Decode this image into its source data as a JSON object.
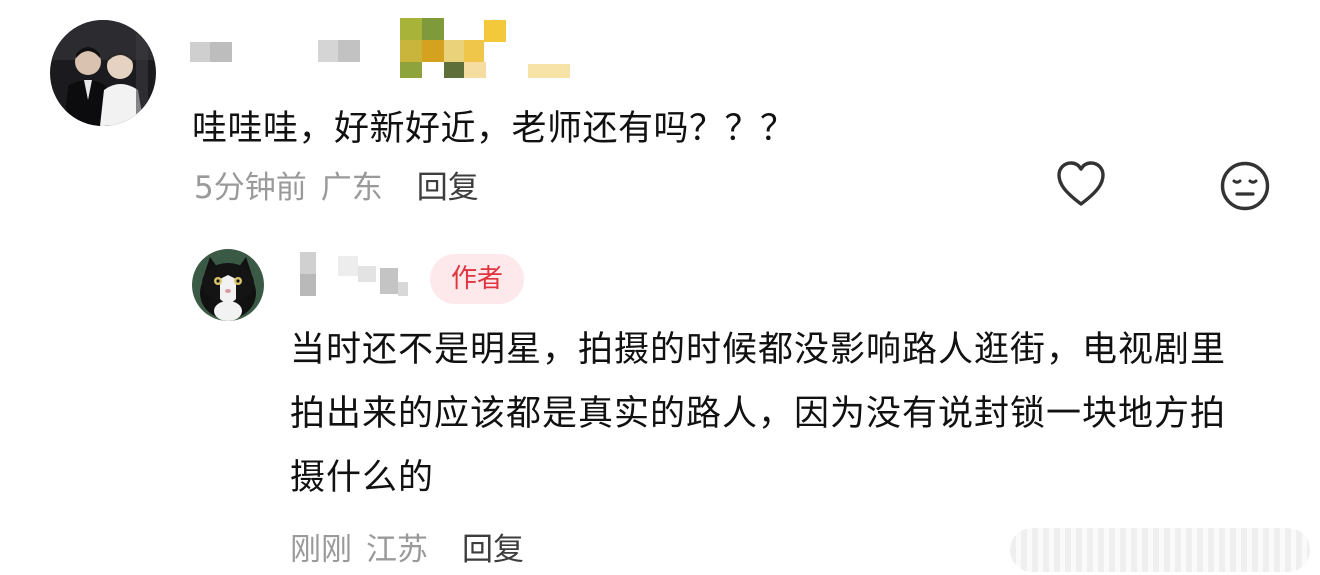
{
  "comment": {
    "text": "哇哇哇，好新好近，老师还有吗？？？",
    "time": "5分钟前",
    "location": "广东",
    "reply_label": "回复"
  },
  "reply": {
    "author_badge": "作者",
    "text": "当时还不是明星，拍摄的时候都没影响路人逛街，电视剧里拍出来的应该都是真实的路人，因为没有说封锁一块地方拍摄什么的",
    "time": "刚刚",
    "location": "江苏",
    "reply_label": "回复"
  },
  "icons": {
    "like": "heart-outline-icon",
    "dislike": "neutral-face-icon"
  },
  "colors": {
    "badge_bg": "#fde9ec",
    "badge_text": "#e0343f",
    "meta_text": "#9a9a9a"
  }
}
